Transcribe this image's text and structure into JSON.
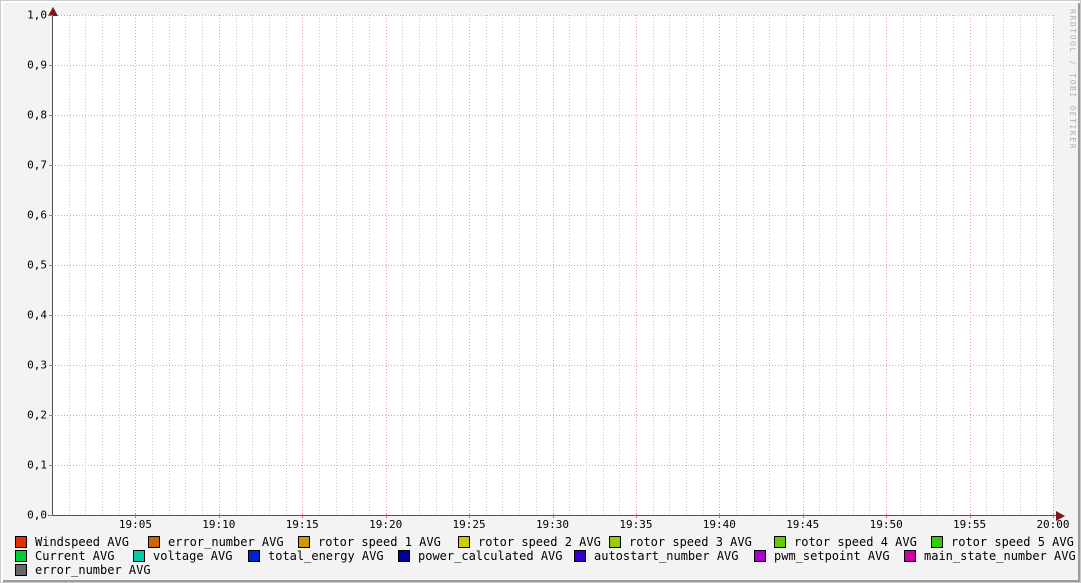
{
  "watermark": "RRDTOOL / TOBI OETIKER",
  "chart_data": {
    "type": "line",
    "title": "",
    "xlabel": "",
    "ylabel": "",
    "x_range": [
      "19:00",
      "20:00"
    ],
    "ylim": [
      0.0,
      1.0
    ],
    "grid": true,
    "legend_position": "bottom",
    "x_ticks": [
      "19:05",
      "19:10",
      "19:15",
      "19:20",
      "19:25",
      "19:30",
      "19:35",
      "19:40",
      "19:45",
      "19:50",
      "19:55",
      "20:00"
    ],
    "y_ticks": [
      "1,0",
      "0,9",
      "0,8",
      "0,7",
      "0,6",
      "0,5",
      "0,4",
      "0,3",
      "0,2",
      "0,1",
      "0,0"
    ],
    "series": [
      {
        "name": "Windspeed AVG",
        "color": "#e03000",
        "legend_row": 0,
        "values": []
      },
      {
        "name": "error_number AVG",
        "color": "#cc6600",
        "legend_row": 0,
        "values": []
      },
      {
        "name": "rotor speed 1 AVG",
        "color": "#cc9900",
        "legend_row": 0,
        "values": []
      },
      {
        "name": "rotor speed 2 AVG",
        "color": "#cccc00",
        "legend_row": 0,
        "values": []
      },
      {
        "name": "rotor speed 3 AVG",
        "color": "#99cc00",
        "legend_row": 0,
        "values": []
      },
      {
        "name": "rotor speed 4 AVG",
        "color": "#66cc00",
        "legend_row": 0,
        "values": []
      },
      {
        "name": "rotor speed 5 AVG",
        "color": "#33cc00",
        "legend_row": 0,
        "values": []
      },
      {
        "name": "Current AVG",
        "color": "#00cc33",
        "legend_row": 1,
        "values": []
      },
      {
        "name": "voltage AVG",
        "color": "#00ccaa",
        "legend_row": 1,
        "values": []
      },
      {
        "name": "total_energy AVG",
        "color": "#0022cc",
        "legend_row": 1,
        "values": []
      },
      {
        "name": "power_calculated AVG",
        "color": "#000099",
        "legend_row": 1,
        "values": []
      },
      {
        "name": "autostart_number AVG",
        "color": "#3300cc",
        "legend_row": 1,
        "values": []
      },
      {
        "name": "pwm_setpoint AVG",
        "color": "#aa00cc",
        "legend_row": 1,
        "values": []
      },
      {
        "name": "main_state_number AVG",
        "color": "#cc00aa",
        "legend_row": 1,
        "values": []
      },
      {
        "name": "error_number AVG",
        "color": "#666666",
        "legend_row": 2,
        "values": []
      }
    ]
  }
}
